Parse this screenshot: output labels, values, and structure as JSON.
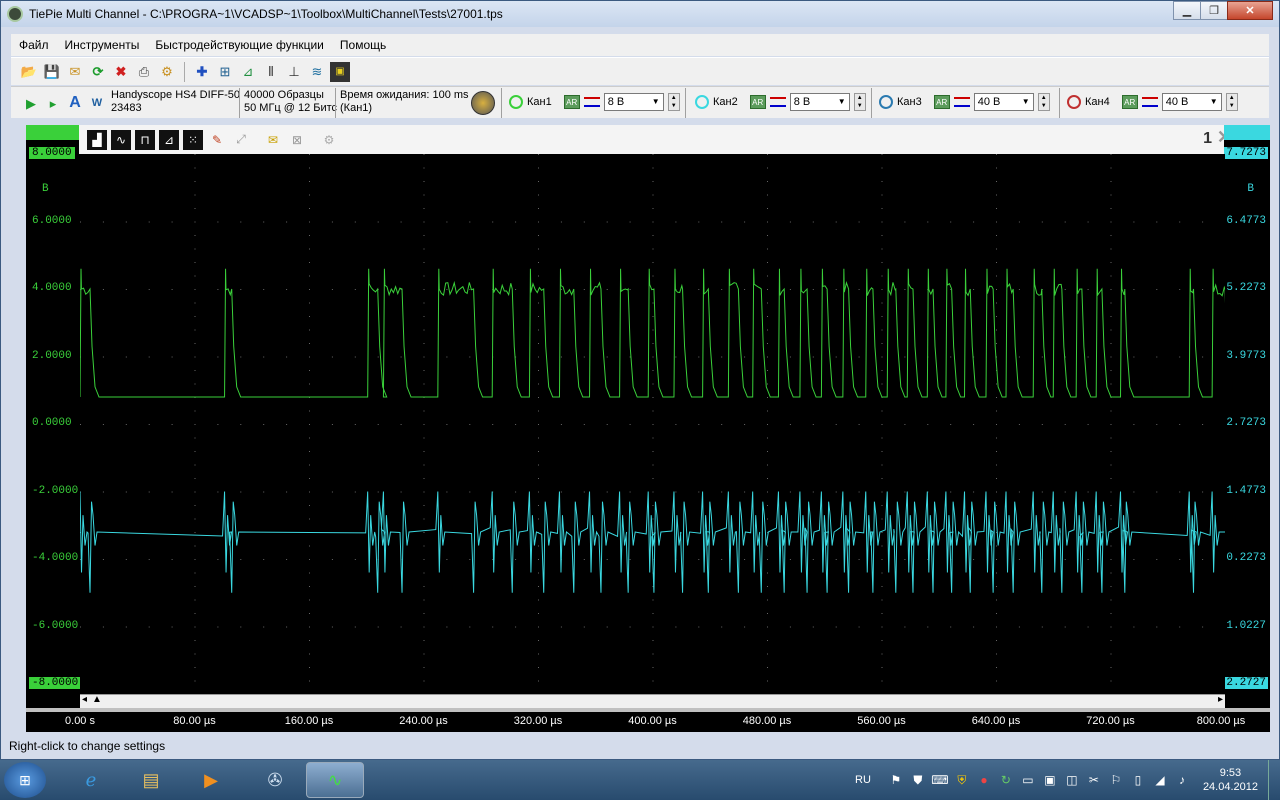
{
  "window": {
    "title": "TiePie Multi Channel - C:\\PROGRA~1\\VCADSP~1\\Toolbox\\MultiChannel\\Tests\\27001.tps"
  },
  "menu": [
    "Файл",
    "Инструменты",
    "Быстродействующие функции",
    "Помощь"
  ],
  "instrument": {
    "name": "Handyscope HS4 DIFF-50",
    "serial": "23483"
  },
  "acquisition": {
    "samples": "40000 Образцы",
    "rate": "50 МГц @ 12 Битс"
  },
  "trigger": {
    "timeout": "Время ожидания:  100 ms",
    "source": "(Кан1)"
  },
  "channels": [
    {
      "label": "Кан1",
      "ar": "AR",
      "range": "8 В",
      "color": "#3ad03a"
    },
    {
      "label": "Кан2",
      "ar": "AR",
      "range": "8 В",
      "color": "#3ad8e0"
    },
    {
      "label": "Кан3",
      "ar": "AR",
      "range": "40 В",
      "color": "#2a7ab0"
    },
    {
      "label": "Кан4",
      "ar": "AR",
      "range": "40 В",
      "color": "#c03030"
    }
  ],
  "scope": {
    "number": "1",
    "left_axis": {
      "unit": "В",
      "labels": [
        "8.0000",
        "6.0000",
        "4.0000",
        "2.0000",
        "0.0000",
        "-2.0000",
        "-4.0000",
        "-6.0000",
        "-8.0000"
      ]
    },
    "right_axis": {
      "unit": "В",
      "labels": [
        "7.7273",
        "6.4773",
        "5.2273",
        "3.9773",
        "2.7273",
        "1.4773",
        "0.2273",
        "-1.0227",
        "-2.2727"
      ]
    },
    "time_labels": [
      "0.00 s",
      "80.00 µs",
      "160.00 µs",
      "240.00 µs",
      "320.00 µs",
      "400.00 µs",
      "480.00 µs",
      "560.00 µs",
      "640.00 µs",
      "720.00 µs",
      "800.00 µs"
    ]
  },
  "status": "Right-click to change settings",
  "tray": {
    "lang": "RU",
    "time": "9:53",
    "date": "24.04.2012"
  },
  "chart_data": {
    "type": "line",
    "xlabel": "",
    "ylabel": "В",
    "xlim_us": [
      0,
      800
    ],
    "ylim": [
      -8,
      8
    ],
    "ylim_right": [
      -2.2727,
      7.7273
    ],
    "series": [
      {
        "color": "#3ad03a",
        "low": 0.8,
        "high": 4.0,
        "y_axis": "left",
        "pulses_us": [
          [
            0,
            7
          ],
          [
            101,
            106
          ],
          [
            201,
            208
          ],
          [
            212,
            225
          ],
          [
            250,
            275
          ],
          [
            288,
            302
          ],
          [
            314,
            324
          ],
          [
            335,
            345
          ],
          [
            356,
            364
          ],
          [
            377,
            383
          ],
          [
            397,
            401
          ],
          [
            415,
            421
          ],
          [
            435,
            439
          ],
          [
            453,
            460
          ],
          [
            470,
            476
          ],
          [
            488,
            492
          ],
          [
            503,
            508
          ],
          [
            518,
            522
          ],
          [
            533,
            537
          ],
          [
            549,
            554
          ],
          [
            564,
            570
          ],
          [
            578,
            582
          ],
          [
            592,
            596
          ],
          [
            605,
            609
          ],
          [
            618,
            622
          ],
          [
            633,
            638
          ],
          [
            647,
            652
          ],
          [
            666,
            672
          ],
          [
            680,
            686
          ],
          [
            696,
            700
          ],
          [
            710,
            714
          ],
          [
            727,
            730
          ],
          [
            775,
            778
          ],
          [
            791,
            800
          ]
        ]
      },
      {
        "color": "#3ad8e0",
        "baseline": -3.2,
        "y_axis": "left",
        "spikes_us": [
          0,
          7,
          101,
          106,
          201,
          208,
          212,
          225,
          250,
          275,
          288,
          302,
          314,
          324,
          335,
          345,
          356,
          364,
          377,
          383,
          397,
          401,
          415,
          421,
          435,
          439,
          453,
          460,
          470,
          476,
          488,
          492,
          503,
          508,
          518,
          522,
          533,
          537,
          549,
          554,
          564,
          570,
          578,
          582,
          592,
          596,
          605,
          609,
          618,
          622,
          633,
          638,
          647,
          652,
          666,
          672,
          680,
          686,
          696,
          700,
          710,
          714,
          727,
          730,
          775,
          778,
          791
        ]
      }
    ]
  }
}
